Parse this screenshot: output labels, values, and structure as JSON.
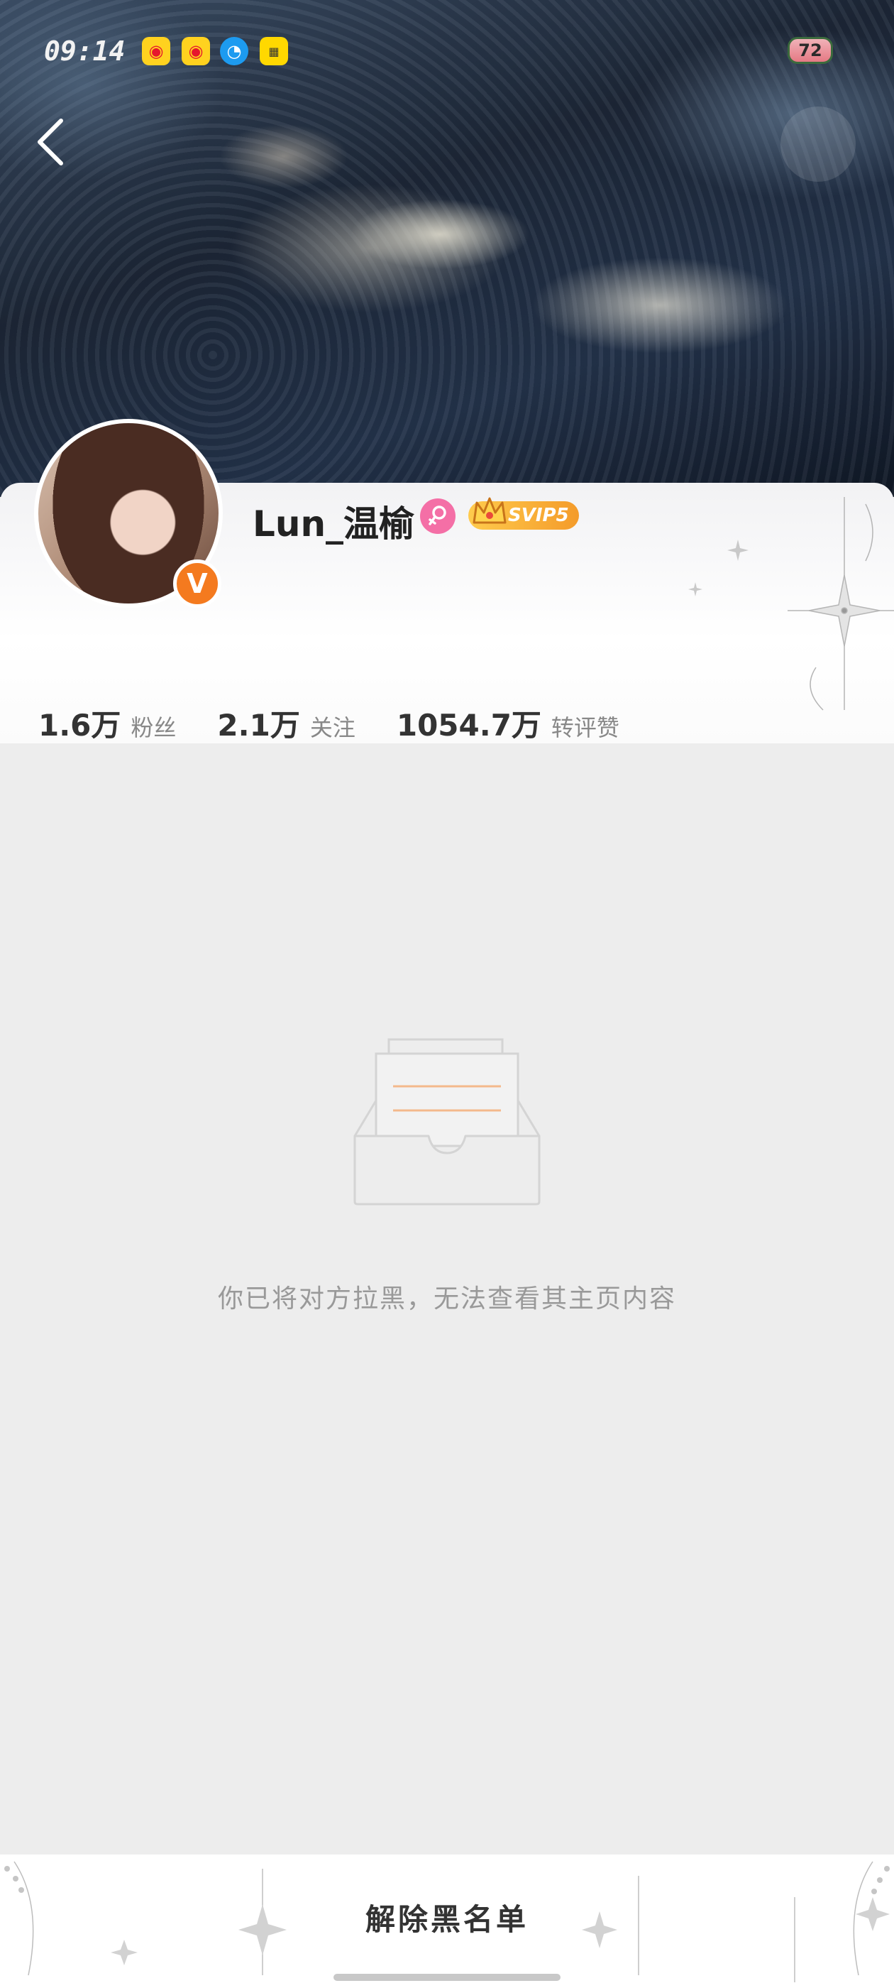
{
  "status_bar": {
    "time": "09:14",
    "battery": "72",
    "icons": [
      "weibo-icon",
      "weibo-icon",
      "qq-icon",
      "tuan-icon"
    ]
  },
  "profile": {
    "name": "Lun_温榆",
    "vip_label": "SVIP5",
    "verified_badge": "V",
    "gender": "female",
    "stats": [
      {
        "value": "1.6万",
        "label": "粉丝"
      },
      {
        "value": "2.1万",
        "label": "关注"
      },
      {
        "value": "1054.7万",
        "label": "转评赞"
      }
    ]
  },
  "main": {
    "blocked_message": "你已将对方拉黑，无法查看其主页内容"
  },
  "bottom": {
    "unblock_label": "解除黑名单"
  },
  "colors": {
    "accent": "#f47a1f",
    "gender": "#f46fa6",
    "vip": "#f49b2a",
    "background": "#ededed"
  }
}
